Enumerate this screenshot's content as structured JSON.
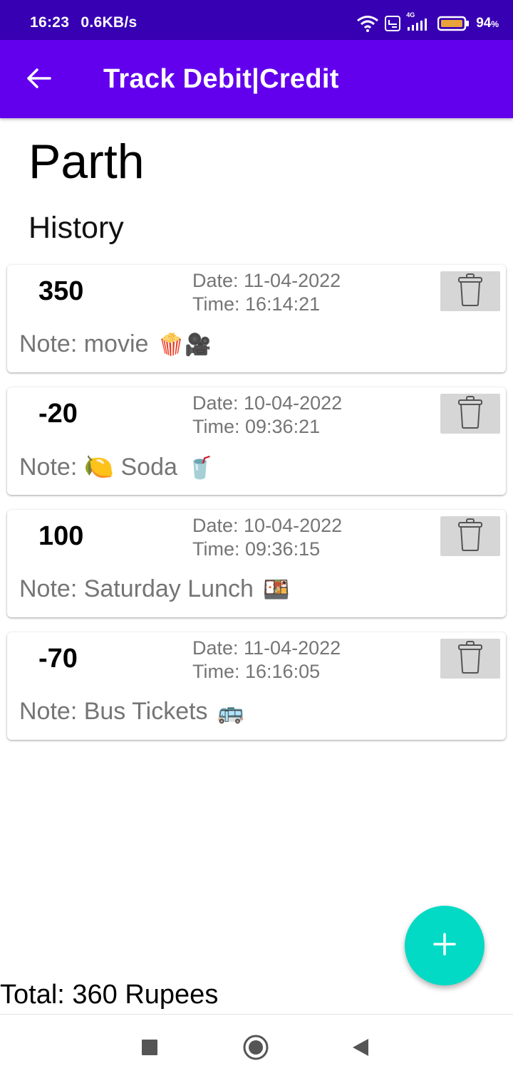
{
  "status_bar": {
    "time": "16:23",
    "speed": "0.6KB/s",
    "network": "4G",
    "battery": "94",
    "battery_unit": "%"
  },
  "app_bar": {
    "title": "Track Debit|Credit"
  },
  "person": {
    "name": "Parth"
  },
  "history_label": "History",
  "transactions": [
    {
      "amount": "350",
      "date": "Date: 11-04-2022",
      "time": "Time: 16:14:21",
      "note": "Note: movie",
      "emoji": "🍿🎥"
    },
    {
      "amount": "-20",
      "date": "Date: 10-04-2022",
      "time": "Time: 09:36:21",
      "note": "Note: 🍋 Soda",
      "emoji": "🥤"
    },
    {
      "amount": "100",
      "date": "Date: 10-04-2022",
      "time": "Time: 09:36:15",
      "note": "Note: Saturday Lunch",
      "emoji": "🍱"
    },
    {
      "amount": "-70",
      "date": "Date: 11-04-2022",
      "time": "Time: 16:16:05",
      "note": "Note: Bus Tickets",
      "emoji": "🚌"
    }
  ],
  "total": "Total: 360 Rupees",
  "colors": {
    "status_bar": "#3700b3",
    "app_bar": "#6200ee",
    "fab": "#03dac5",
    "secondary_text": "#757575",
    "trash_button_bg": "#d6d6d6"
  },
  "icons": {
    "back": "arrow-left-icon",
    "delete": "trash-icon",
    "add": "plus-icon",
    "nav_recents": "square-icon",
    "nav_home": "circle-icon",
    "nav_back": "triangle-back-icon"
  }
}
